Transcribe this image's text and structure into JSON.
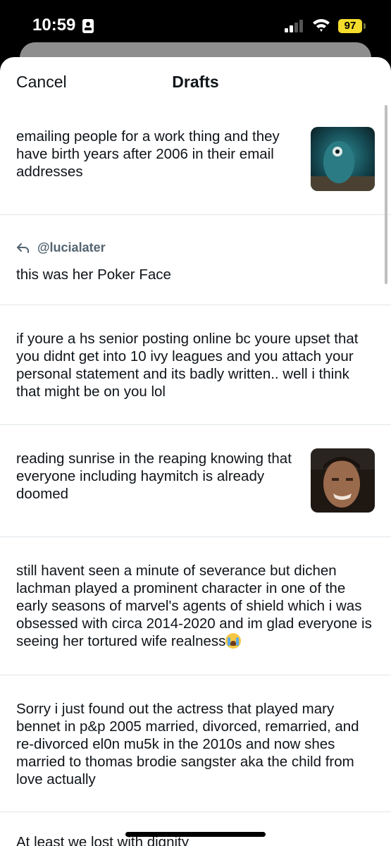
{
  "status_bar": {
    "time": "10:59",
    "battery": "97",
    "battery_color": "#f4dc2c"
  },
  "header": {
    "cancel_label": "Cancel",
    "title": "Drafts"
  },
  "drafts": [
    {
      "text": "emailing people for a work thing and they have birth years after 2006 in their email addresses",
      "has_image": true
    },
    {
      "reply_to": "@lucialater",
      "text": "this was her Poker Face"
    },
    {
      "text": "if youre a hs senior posting online bc youre upset that you didnt get into 10 ivy leagues and you attach your personal statement and its badly written.. well i think that might be on you lol"
    },
    {
      "text": "reading sunrise in the reaping knowing that everyone including haymitch is already doomed",
      "has_image": true
    },
    {
      "text": "still havent seen a minute of severance but dichen lachman played a prominent character in one of the early seasons of marvel's agents of shield which i was obsessed with circa 2014-2020 and im glad everyone is seeing her tortured wife realness",
      "emoji": "loudly-crying-face-icon"
    },
    {
      "text": "Sorry i just found out the actress that played mary bennet in p&p 2005 married, divorced, remarried, and re-divorced el0n mu5k in the 2010s and now shes married to thomas brodie sangster aka the child from love actually"
    },
    {
      "text": "At least we lost with dignity"
    }
  ]
}
